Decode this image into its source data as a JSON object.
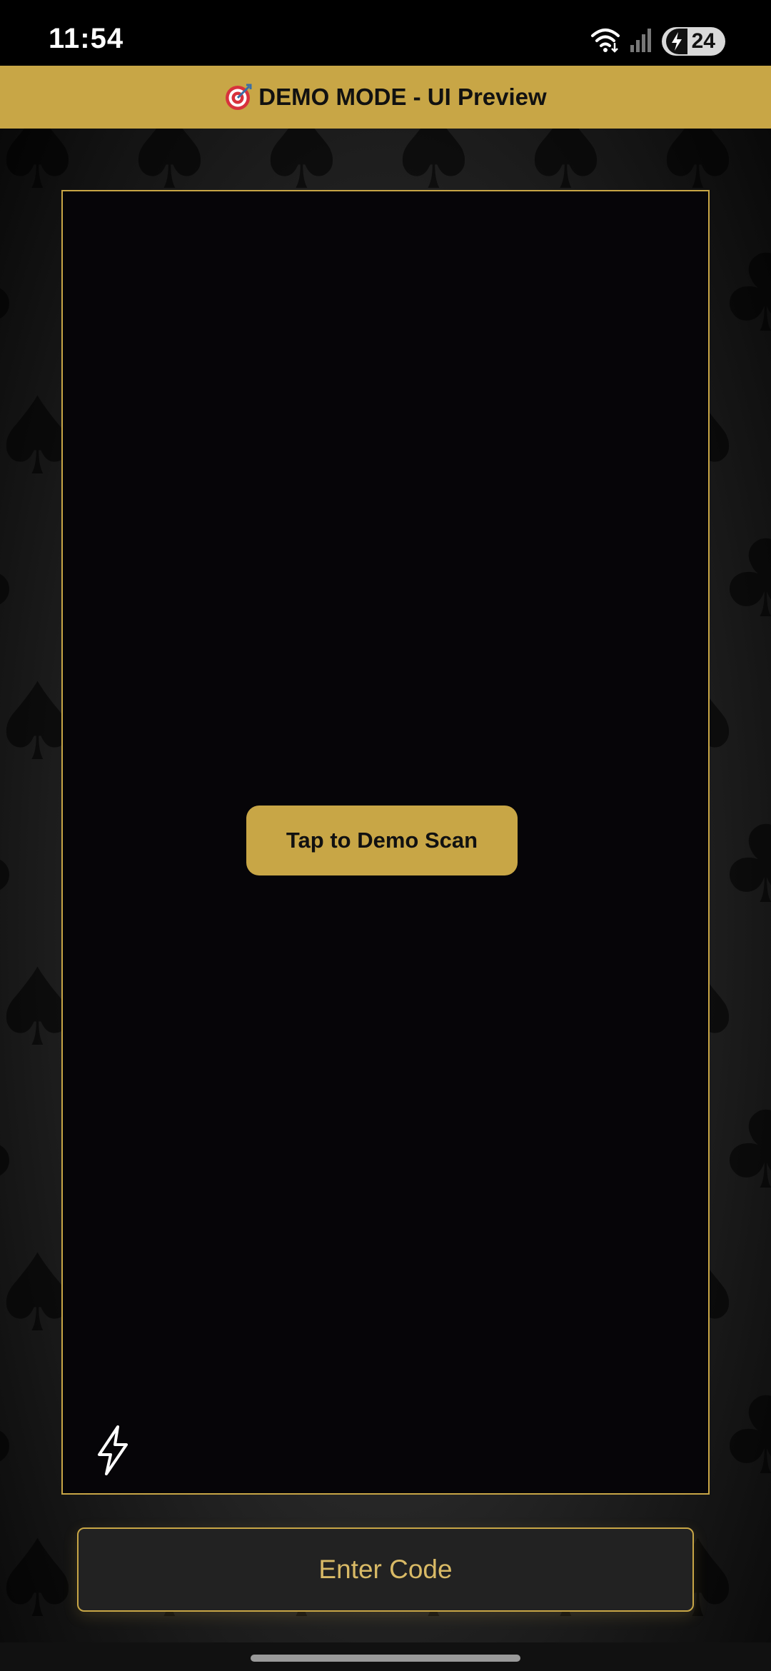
{
  "status_bar": {
    "time": "11:54",
    "battery_level": "24",
    "icons": [
      "wifi-icon",
      "cell-signal-icon",
      "charging-bolt-icon"
    ]
  },
  "banner": {
    "icon": "target-icon",
    "text": "DEMO MODE - UI Preview"
  },
  "scanner": {
    "demo_button_label": "Tap to Demo Scan",
    "flash_icon": "flash-icon"
  },
  "footer": {
    "enter_code_label": "Enter Code"
  },
  "colors": {
    "accent_gold": "#c8a646",
    "gold_text": "#d9ba66",
    "background": "#060508"
  }
}
